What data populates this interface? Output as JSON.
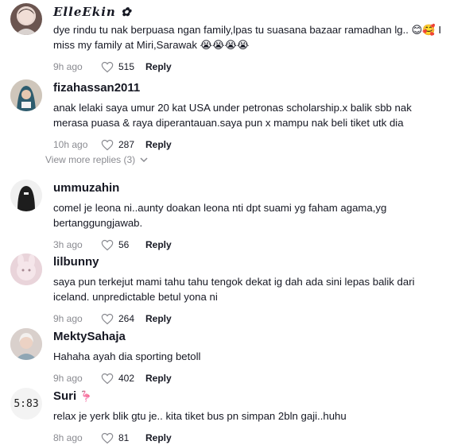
{
  "comments": [
    {
      "username": "ElleEkin",
      "username_deco": "✿",
      "text": "dye rindu tu nak berpuasa ngan family,lpas tu suasana bazaar ramadhan lg.. 😊🥰 I miss my family at Miri,Sarawak 😭😭😭😭",
      "time": "9h ago",
      "likes": "515",
      "reply": "Reply"
    },
    {
      "username": "fizahassan2011",
      "text": "anak lelaki saya umur 20 kat USA under petronas scholarship.x balik sbb nak merasa puasa & raya diperantauan.saya pun x mampu nak beli tiket utk dia",
      "time": "10h ago",
      "likes": "287",
      "reply": "Reply",
      "view_more": "View more replies (3)"
    },
    {
      "username": "ummuzahin",
      "text": "comel je leona ni..aunty doakan leona nti dpt suami yg faham agama,yg bertanggungjawab.",
      "time": "3h ago",
      "likes": "56",
      "reply": "Reply"
    },
    {
      "username": "lilbunny",
      "text": "saya pun terkejut mami tahu tahu tengok dekat ig dah ada sini lepas balik dari iceland. unpredictable betul yona ni",
      "time": "9h ago",
      "likes": "264",
      "reply": "Reply"
    },
    {
      "username": "MektySahaja",
      "text": "Hahaha ayah dia sporting betoll",
      "time": "9h ago",
      "likes": "402",
      "reply": "Reply"
    },
    {
      "username": "Suri",
      "username_deco": "🦩",
      "avatar_text": "5:83",
      "text": "relax je yerk blik gtu je.. kita tiket bus pn simpan 2bln gaji..huhu",
      "time": "8h ago",
      "likes": "81",
      "reply": "Reply"
    }
  ]
}
